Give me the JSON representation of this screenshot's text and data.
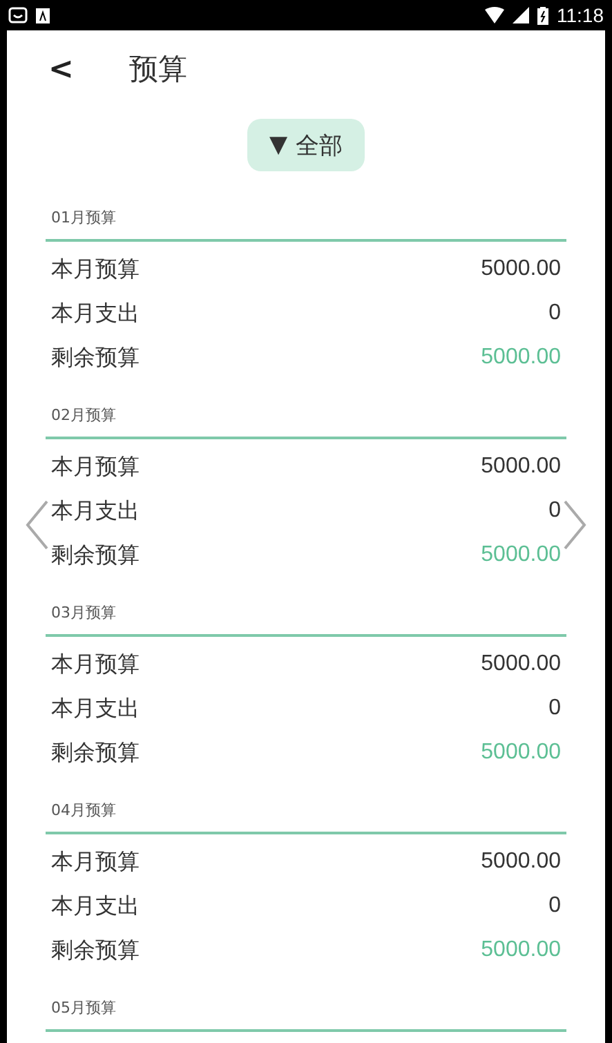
{
  "status_bar": {
    "time": "11:18"
  },
  "header": {
    "back": "<",
    "title": "预算"
  },
  "filter": {
    "arrow": "▼",
    "label": "全部"
  },
  "months": [
    {
      "label": "01月预算",
      "rows": [
        {
          "kind": "amount",
          "name": "本月预算",
          "value": "5000.00"
        },
        {
          "kind": "amount",
          "name": "本月支出",
          "value": "0"
        },
        {
          "kind": "balance",
          "name": "剩余预算",
          "value": "5000.00"
        }
      ]
    },
    {
      "label": "02月预算",
      "rows": [
        {
          "kind": "amount",
          "name": "本月预算",
          "value": "5000.00"
        },
        {
          "kind": "amount",
          "name": "本月支出",
          "value": "0"
        },
        {
          "kind": "balance",
          "name": "剩余预算",
          "value": "5000.00"
        }
      ]
    },
    {
      "label": "03月预算",
      "rows": [
        {
          "kind": "amount",
          "name": "本月预算",
          "value": "5000.00"
        },
        {
          "kind": "amount",
          "name": "本月支出",
          "value": "0"
        },
        {
          "kind": "balance",
          "name": "剩余预算",
          "value": "5000.00"
        }
      ]
    },
    {
      "label": "04月预算",
      "rows": [
        {
          "kind": "amount",
          "name": "本月预算",
          "value": "5000.00"
        },
        {
          "kind": "amount",
          "name": "本月支出",
          "value": "0"
        },
        {
          "kind": "balance",
          "name": "剩余预算",
          "value": "5000.00"
        }
      ]
    },
    {
      "label": "05月预算"
    }
  ]
}
